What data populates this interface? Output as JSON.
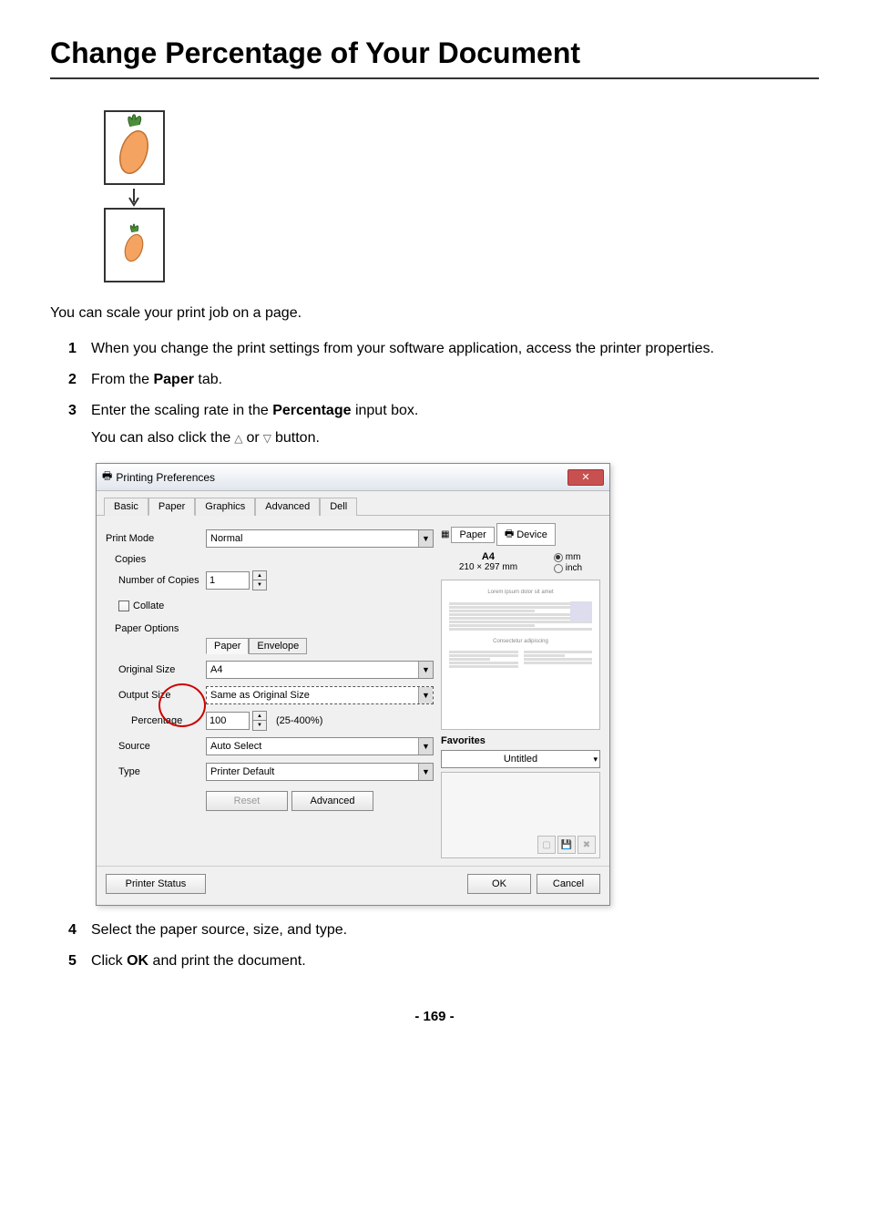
{
  "page": {
    "title": "Change Percentage of Your Document",
    "intro": "You can scale your print job on a page.",
    "page_number": "169"
  },
  "steps": [
    {
      "num": "1",
      "text_before": "When you change the print settings from your software application, access the printer properties."
    },
    {
      "num": "2",
      "text_before": "From the ",
      "bold1": "Paper",
      "text_after": " tab."
    },
    {
      "num": "3",
      "text_before": "Enter the scaling rate in the ",
      "bold1": "Percentage",
      "text_after": " input box.",
      "sub_before": "You can also click the ",
      "sub_after": " button.",
      "sub_mid": " or "
    },
    {
      "num": "4",
      "text_before": "Select the paper source, size, and type."
    },
    {
      "num": "5",
      "text_before": "Click ",
      "bold1": "OK",
      "text_after": " and print the document."
    }
  ],
  "dialog": {
    "title": "Printing Preferences",
    "tabs": [
      "Basic",
      "Paper",
      "Graphics",
      "Advanced",
      "Dell"
    ],
    "active_tab": "Paper",
    "print_mode_label": "Print Mode",
    "print_mode_value": "Normal",
    "copies_label": "Copies",
    "num_copies_label": "Number of Copies",
    "num_copies_value": "1",
    "collate_label": "Collate",
    "paper_options_label": "Paper Options",
    "paper_sub_tabs": [
      "Paper",
      "Envelope"
    ],
    "original_size_label": "Original Size",
    "original_size_value": "A4",
    "output_size_label": "Output Size",
    "output_size_value": "Same as Original Size",
    "percentage_label": "Percentage",
    "percentage_value": "100",
    "percentage_range": "(25-400%)",
    "source_label": "Source",
    "source_value": "Auto Select",
    "type_label": "Type",
    "type_value": "Printer Default",
    "reset_btn": "Reset",
    "advanced_btn": "Advanced",
    "preview_tabs": [
      "Paper",
      "Device"
    ],
    "paper_size": "A4",
    "paper_dims": "210 × 297 mm",
    "unit_mm": "mm",
    "unit_inch": "inch",
    "favorites_label": "Favorites",
    "favorites_value": "Untitled",
    "printer_status_btn": "Printer Status",
    "ok_btn": "OK",
    "cancel_btn": "Cancel"
  }
}
